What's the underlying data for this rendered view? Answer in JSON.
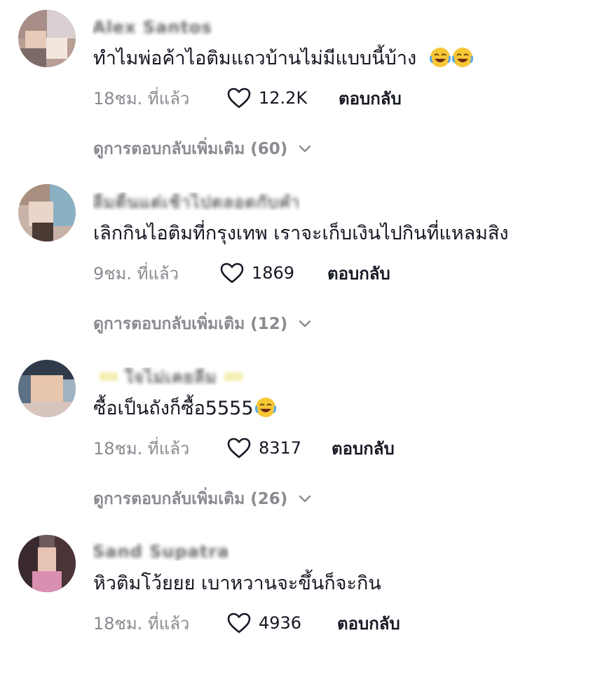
{
  "comments": [
    {
      "username": "Alex Santos",
      "text": "ทำไมพ่อค้าไอติมแถวบ้านไม่มีแบบนี้บ้าง",
      "emoji": [
        "face-with-tears-of-joy",
        "face-with-tears-of-joy"
      ],
      "time": "18ชม. ที่แล้ว",
      "likes": "12.2K",
      "reply_label": "ตอบกลับ",
      "more_replies": "ดูการตอบกลับเพิ่มเติม (60)"
    },
    {
      "username": "ลืมตื่นแต่เช้าไปตลอดกับคำ",
      "text": "เลิกกินไอติมที่กรุงเทพ เราจะเก็บเงินไปกินที่แหลมสิง",
      "emoji": [],
      "time": "9ชม. ที่แล้ว",
      "likes": "1869",
      "reply_label": "ตอบกลับ",
      "more_replies": "ดูการตอบกลับเพิ่มเติม (12)"
    },
    {
      "username": "ใจไม่เคยลืม",
      "text": "ซื้อเป็นถังก็ซื้อ5555",
      "emoji": [
        "face-with-tears-of-joy"
      ],
      "time": "18ชม. ที่แล้ว",
      "likes": "8317",
      "reply_label": "ตอบกลับ",
      "more_replies": "ดูการตอบกลับเพิ่มเติม (26)"
    },
    {
      "username": "Sand Supatra",
      "text": "หิวติมโว้ยยย เบาหวานจะขึ้นก็จะกิน",
      "emoji": [],
      "time": "18ชม. ที่แล้ว",
      "likes": "4936",
      "reply_label": "ตอบกลับ"
    }
  ],
  "icons": {
    "like": "heart-outline-icon",
    "expand": "chevron-down-icon",
    "avatar": "avatar"
  },
  "colors": {
    "text": "#161823",
    "secondary": "#8a8b91",
    "background": "#ffffff",
    "emoji_face": "#f7c736"
  }
}
